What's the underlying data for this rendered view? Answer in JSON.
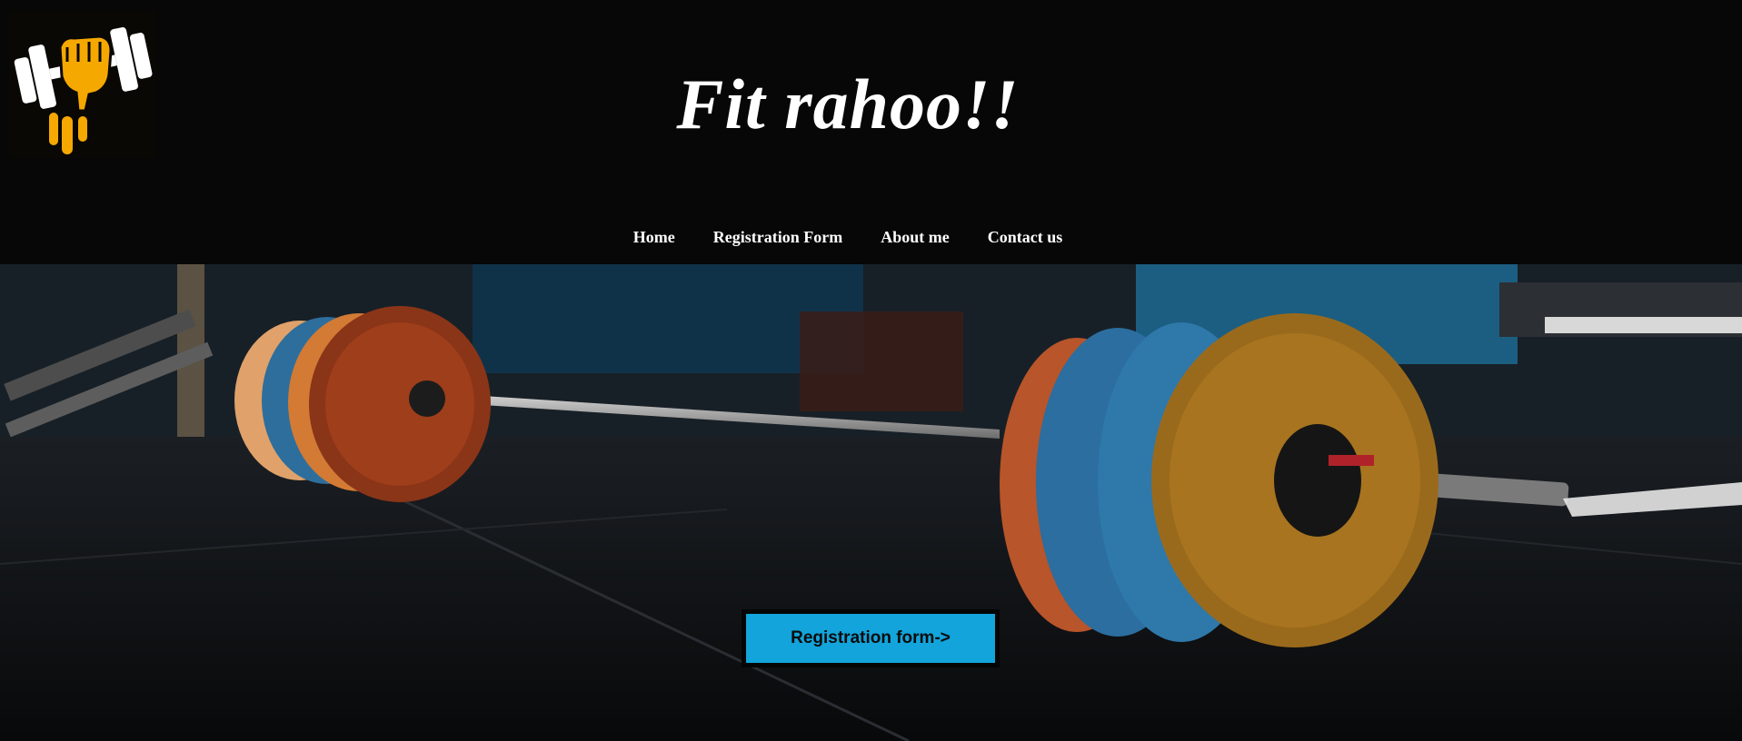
{
  "header": {
    "title": "Fit rahoo!!",
    "logo_icon": "dumbbell-fist-icon",
    "logo_colors": {
      "fist": "#f5a800",
      "dumbbell": "#ffffff"
    }
  },
  "nav": {
    "items": [
      {
        "label": "Home"
      },
      {
        "label": "Registration Form"
      },
      {
        "label": "About me"
      },
      {
        "label": "Contact us"
      }
    ]
  },
  "hero": {
    "image": "gym-barbell-photo",
    "cta_label": "Registration form->",
    "cta_color": "#12a4db"
  }
}
